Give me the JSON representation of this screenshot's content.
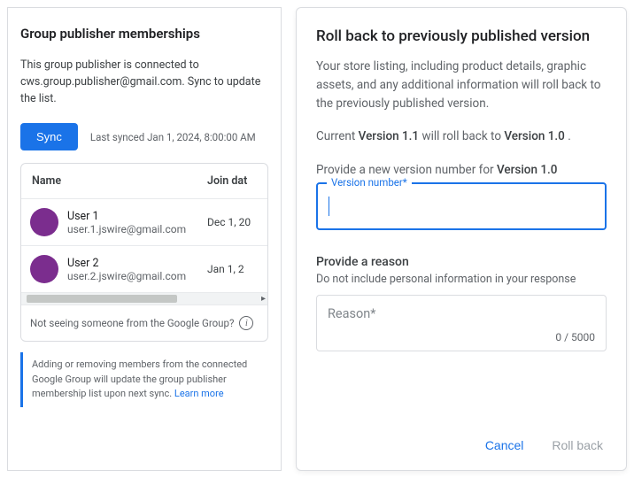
{
  "left": {
    "title": "Group publisher memberships",
    "description": "This group publisher is connected to cws.group.publisher@gmail.com. Sync to update the list.",
    "sync_button": "Sync",
    "last_synced": "Last synced Jan 1, 2024, 8:00:00 AM",
    "columns": {
      "name": "Name",
      "join_date": "Join dat"
    },
    "users": [
      {
        "name": "User 1",
        "email": "user.1.jswire@gmail.com",
        "date": "Dec 1, 20"
      },
      {
        "name": "User 2",
        "email": "user.2.jswire@gmail.com",
        "date": "Jan 1, 2"
      }
    ],
    "not_seeing": "Not seeing someone from the Google Group?",
    "footer_note": "Adding or removing members from the connected Google Group will update the group publisher membership list upon next sync. ",
    "learn_more": "Learn more"
  },
  "right": {
    "title": "Roll back to previously published version",
    "description": "Your store listing, including product details, graphic assets, and any additional information will roll back to the previously published version.",
    "current_label": "Current ",
    "current_version": "Version 1.1",
    "will_roll_back": " will roll back to ",
    "target_version": "Version 1.0",
    "period": " .",
    "provide_version_prefix": "Provide a new version number for ",
    "provide_version_target": "Version 1.0",
    "version_input_label": "Version number*",
    "reason_heading": "Provide a reason",
    "reason_sub": "Do not include personal information in your response",
    "reason_placeholder": "Reason*",
    "char_count": "0 / 5000",
    "cancel": "Cancel",
    "rollback": "Roll back"
  }
}
